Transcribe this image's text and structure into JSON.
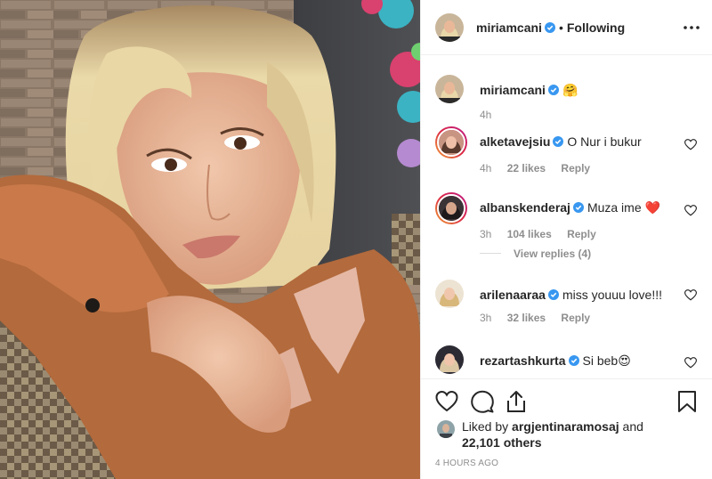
{
  "post": {
    "author": "miriamcani",
    "follow_status": "Following",
    "separator": "•",
    "caption": "🤗",
    "caption_time": "4h",
    "time_ago": "4 HOURS AGO"
  },
  "comments": [
    {
      "username": "alketavejsiu",
      "text": "O Nur i bukur",
      "time": "4h",
      "likes": "22 likes",
      "reply": "Reply"
    },
    {
      "username": "albanskenderaj",
      "text": "Muza ime ❤️",
      "time": "3h",
      "likes": "104 likes",
      "reply": "Reply",
      "view_replies": "View replies (4)"
    },
    {
      "username": "arilenaaraa",
      "text": "miss youuu love!!!",
      "time": "3h",
      "likes": "32 likes",
      "reply": "Reply"
    },
    {
      "username": "rezartashkurta",
      "text": "Si beb😍"
    }
  ],
  "likes_line": {
    "prefix": "Liked by ",
    "user": "argjentinaramosaj",
    "middle": " and",
    "count": "22,101 others"
  },
  "icons": {
    "verified": "verified-badge-icon",
    "more": "more-options-icon",
    "like": "heart-icon",
    "comment": "comment-bubble-icon",
    "share": "share-icon",
    "save": "bookmark-icon"
  },
  "colors": {
    "verified_blue": "#3897f0",
    "text": "#262626",
    "muted": "#8e8e8e",
    "border": "#efefef"
  }
}
